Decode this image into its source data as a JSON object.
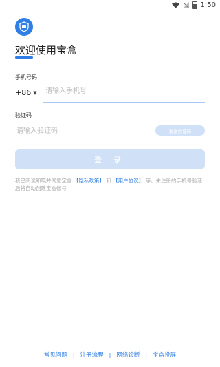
{
  "status_bar": {
    "time": "1:50"
  },
  "header": {
    "title": "欢迎使用宝盒"
  },
  "phone": {
    "label": "手机号码",
    "country_code": "+86",
    "placeholder": "请输入手机号"
  },
  "code": {
    "label": "验证码",
    "placeholder": "请输入验证码",
    "send_label": "发送验证码"
  },
  "login": {
    "label": "登 录"
  },
  "agreement": {
    "text_before": "我已阅读知晓并同意宝盒",
    "privacy_link": "【隐私政策】",
    "and": "和",
    "terms_link": "【用户协议】",
    "text_after": "等。未注册的手机号验证后将自动创建宝盒帐号"
  },
  "footer": {
    "links": [
      "常见问题",
      "注册流程",
      "网络诊断",
      "宝盒投屏"
    ]
  },
  "colors": {
    "accent": "#2f7fe6",
    "disabled": "#cfe0f7"
  }
}
